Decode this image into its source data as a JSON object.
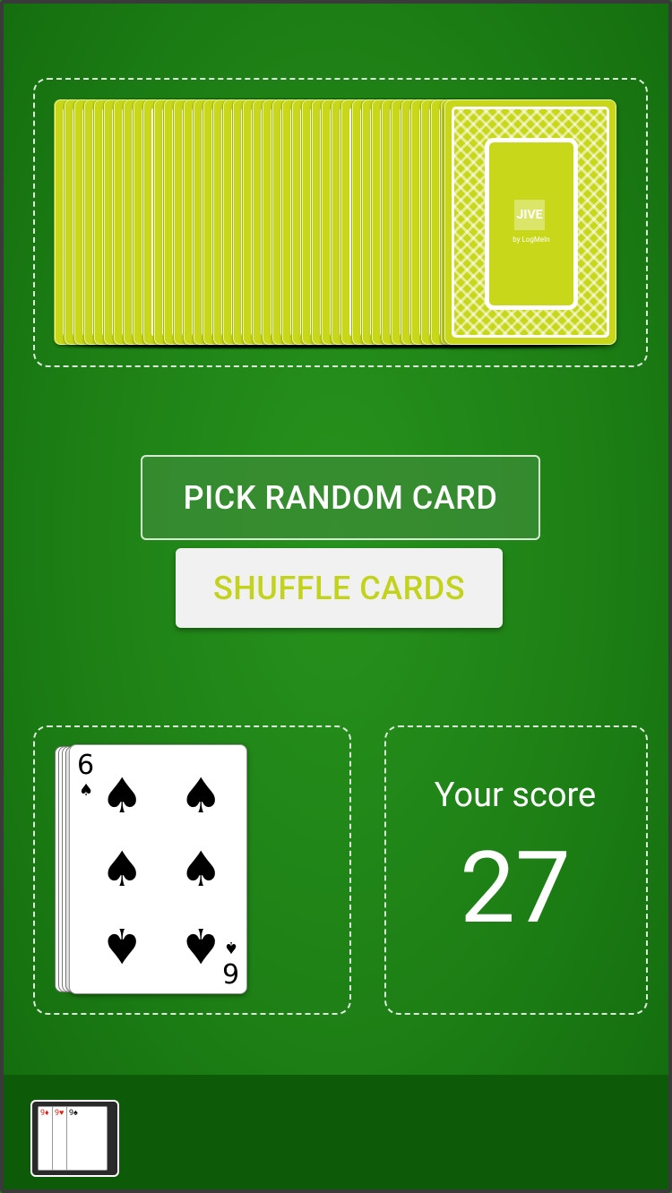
{
  "deck": {
    "card_count_visible": 40,
    "back_color": "#c8d71a",
    "logo_text": "JIVE",
    "logo_subtext": "by LogMeIn"
  },
  "buttons": {
    "pick_label": "PICK RANDOM CARD",
    "shuffle_label": "SHUFFLE CARDS"
  },
  "drawn_card": {
    "rank": "6",
    "suit": "spades",
    "suit_glyph": "♠"
  },
  "score": {
    "label": "Your score",
    "value": "27"
  },
  "bottom_bar": {
    "thumbnail_cards": [
      "9♦",
      "9♥",
      "9♠"
    ]
  },
  "colors": {
    "table_green": "#1e7d16",
    "accent_lime": "#c3d21a",
    "bottom_bar": "#0d5b08"
  }
}
